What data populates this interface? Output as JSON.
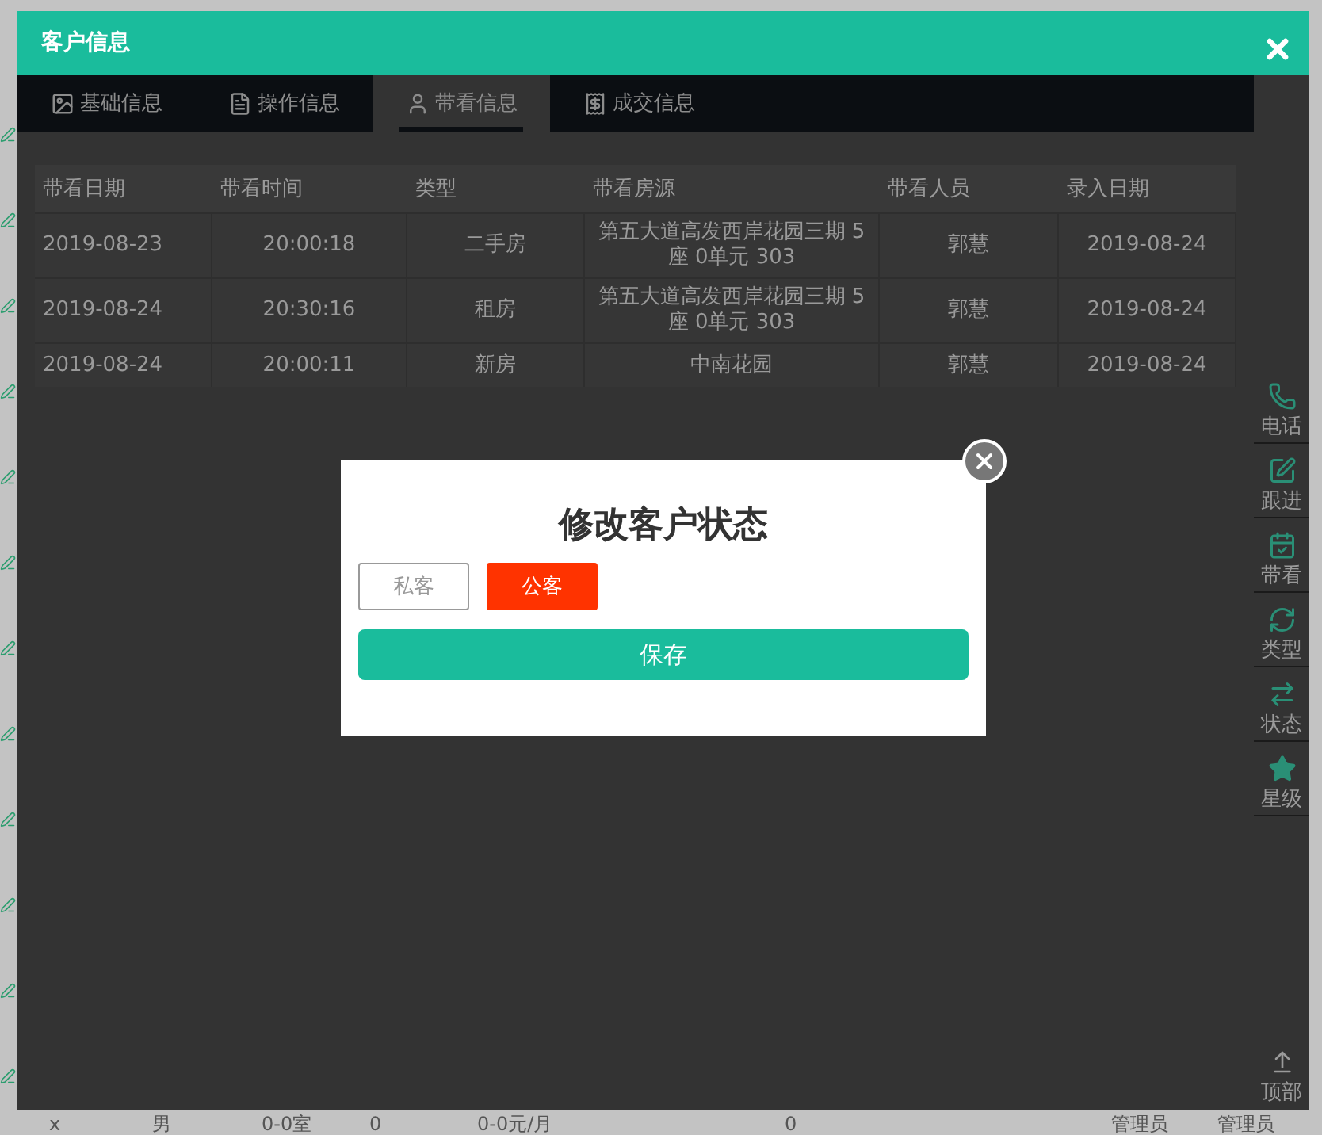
{
  "background_row": [
    "x",
    "男",
    "0-0室",
    "0",
    "0-0元/月",
    "0",
    "管理员",
    "管理员"
  ],
  "dialog": {
    "title": "客户信息",
    "tabs": [
      {
        "label": "基础信息",
        "kind": "image",
        "selected": false
      },
      {
        "label": "操作信息",
        "kind": "document",
        "selected": false
      },
      {
        "label": "带看信息",
        "kind": "person",
        "selected": true
      },
      {
        "label": "成交信息",
        "kind": "receipt",
        "selected": false
      }
    ],
    "table": {
      "columns": [
        "带看日期",
        "带看时间",
        "类型",
        "带看房源",
        "带看人员",
        "录入日期"
      ],
      "rows": [
        [
          "2019-08-23",
          "20:00:18",
          "二手房",
          "第五大道高发西岸花园三期 5座 0单元 303",
          "郭慧",
          "2019-08-24"
        ],
        [
          "2019-08-24",
          "20:30:16",
          "租房",
          "第五大道高发西岸花园三期 5座 0单元 303",
          "郭慧",
          "2019-08-24"
        ],
        [
          "2019-08-24",
          "20:00:11",
          "新房",
          "中南花园",
          "郭慧",
          "2019-08-24"
        ]
      ]
    },
    "side_tools": [
      {
        "label": "电话",
        "kind": "phone"
      },
      {
        "label": "跟进",
        "kind": "note"
      },
      {
        "label": "带看",
        "kind": "calendar"
      },
      {
        "label": "类型",
        "kind": "refresh"
      },
      {
        "label": "状态",
        "kind": "swap"
      },
      {
        "label": "星级",
        "kind": "star"
      }
    ],
    "top_button": "顶部"
  },
  "status_modal": {
    "title": "修改客户状态",
    "options": [
      {
        "label": "私客",
        "selected": false
      },
      {
        "label": "公客",
        "selected": true
      }
    ],
    "save_button": "保存"
  }
}
